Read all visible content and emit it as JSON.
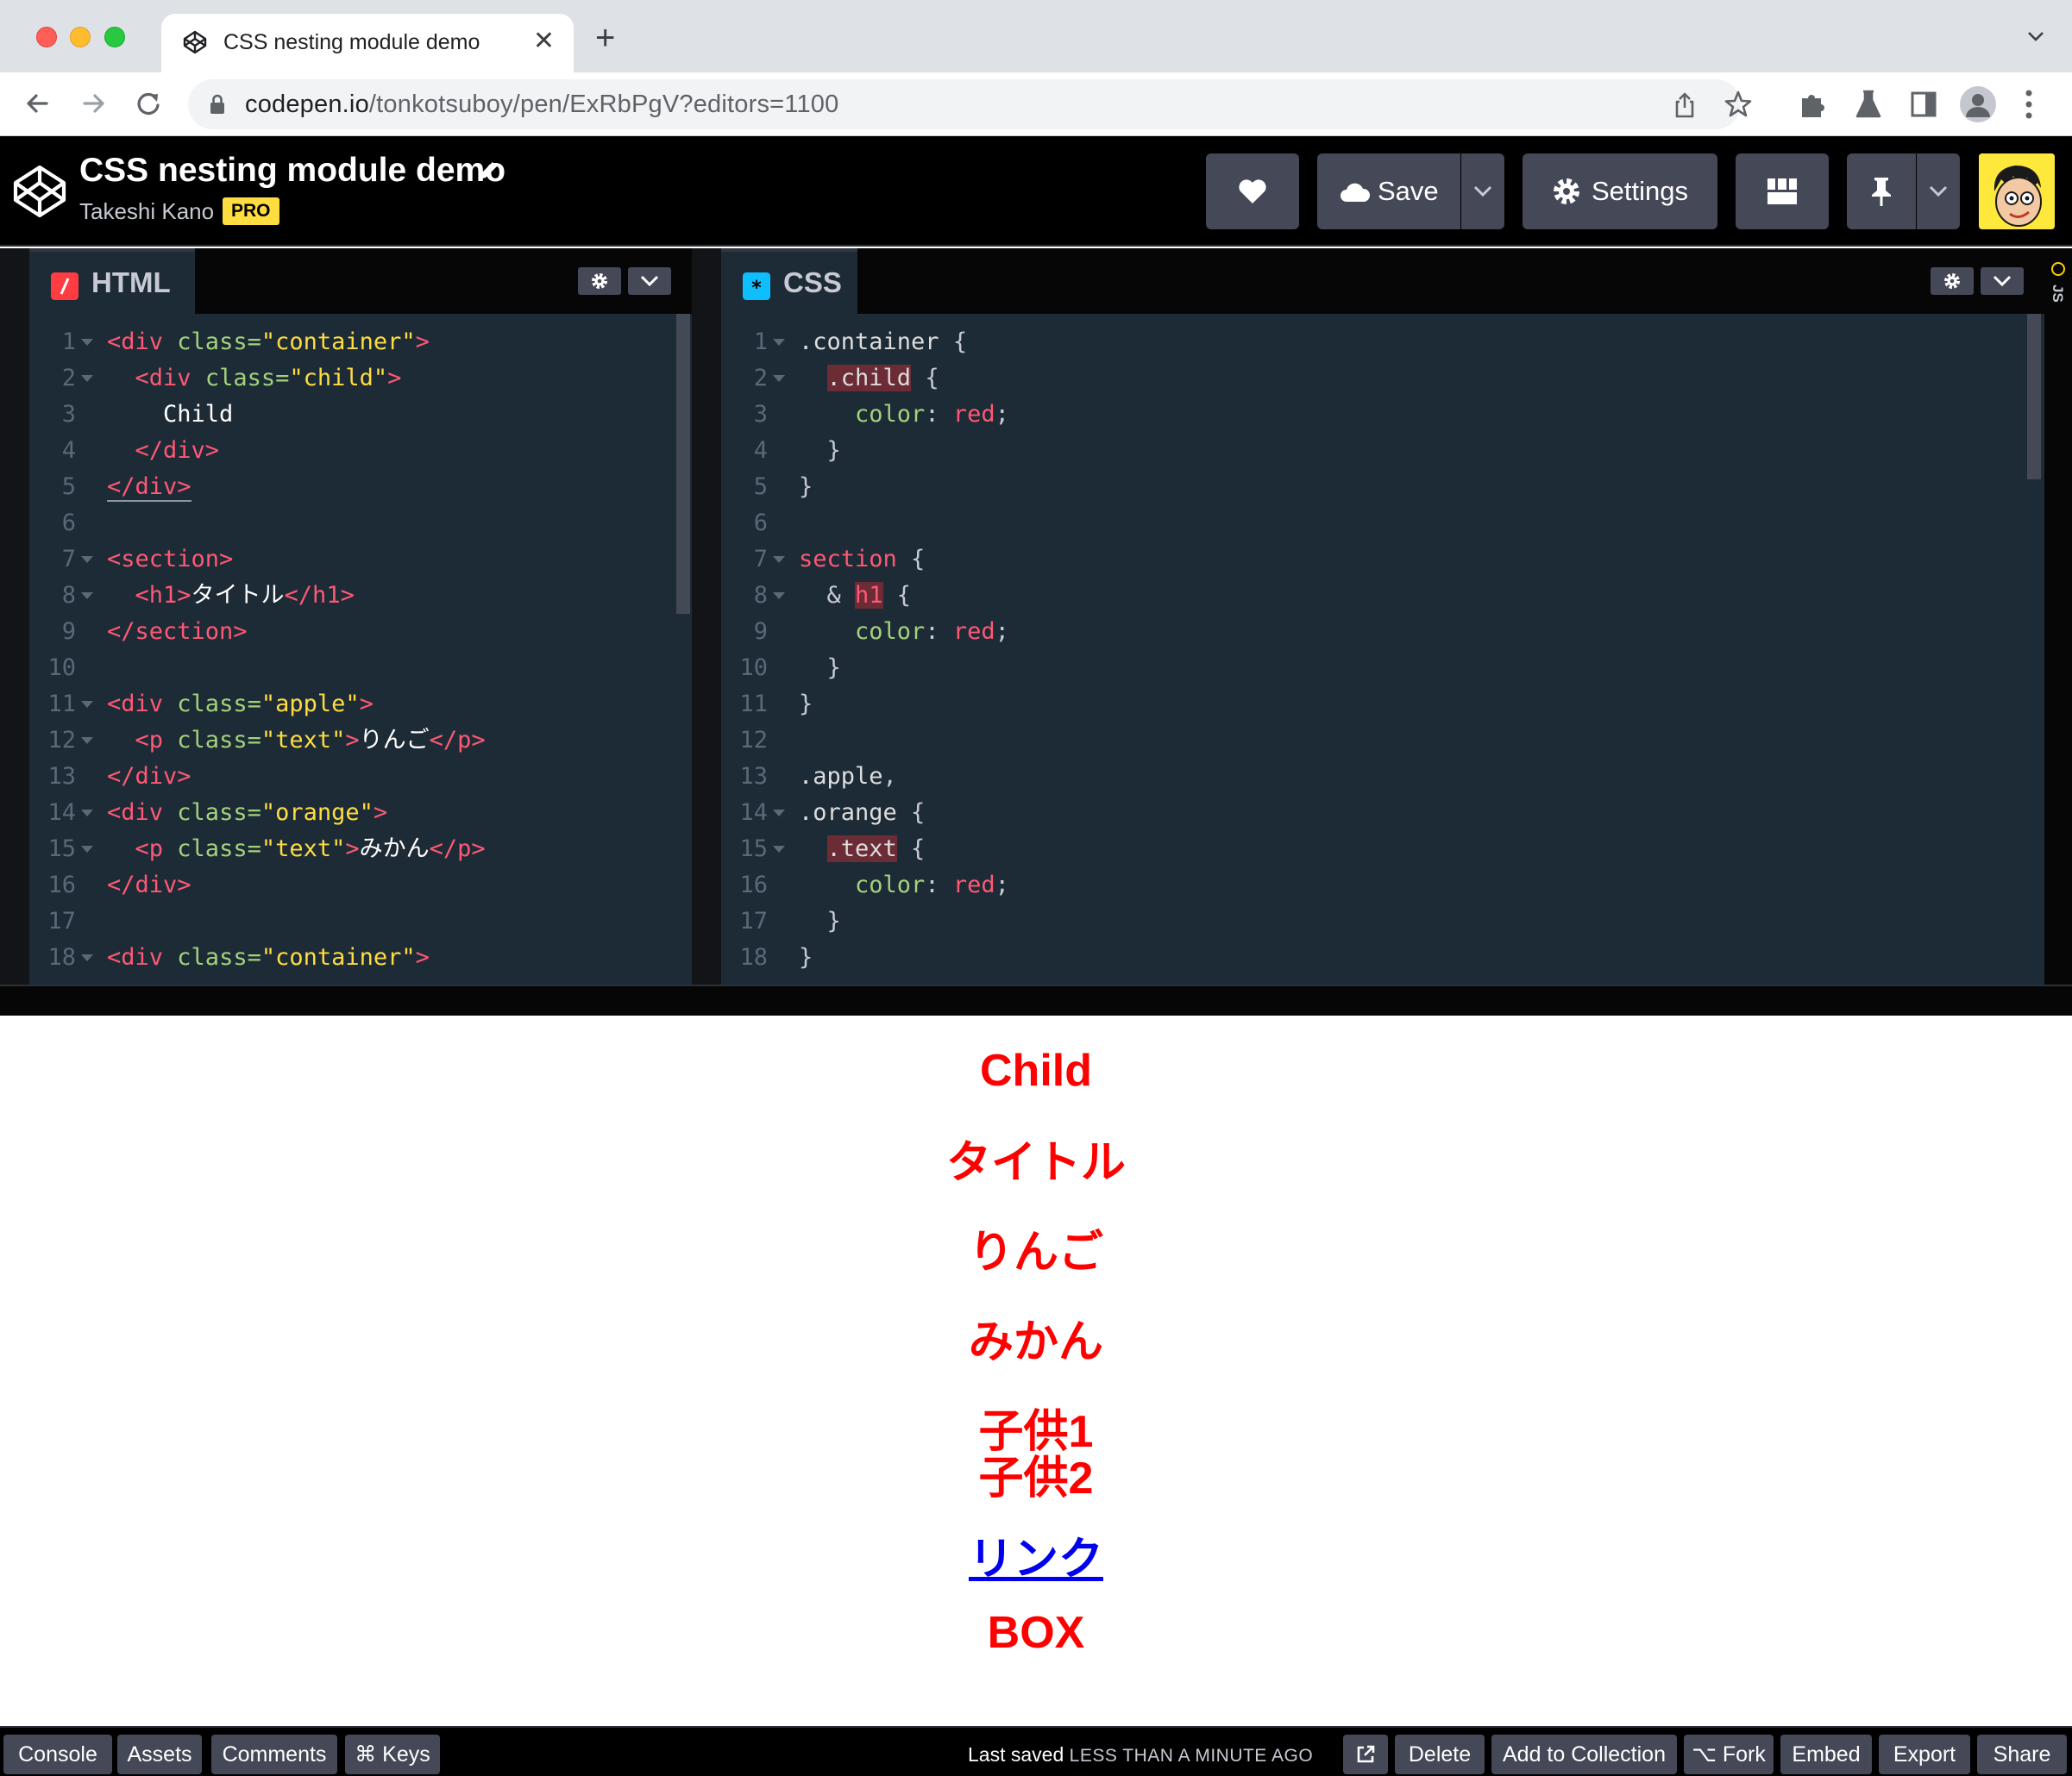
{
  "browser": {
    "tab_title": "CSS nesting module demo",
    "url_host": "codepen.io",
    "url_path": "/tonkotsuboy/pen/ExRbPgV?editors=1100"
  },
  "header": {
    "pen_title": "CSS nesting module demo",
    "author": "Takeshi Kano",
    "badge": "PRO",
    "save_label": "Save",
    "settings_label": "Settings"
  },
  "html_editor": {
    "label": "HTML",
    "lines": [
      {
        "n": "1",
        "fold": true,
        "html": "<span class=\"t-tag\">&lt;div</span> <span class=\"t-attr\">class=</span><span class=\"t-str\">\"container\"</span><span class=\"t-tag\">&gt;</span>"
      },
      {
        "n": "2",
        "fold": true,
        "html": "  <span class=\"t-tag\">&lt;div</span> <span class=\"t-attr\">class=</span><span class=\"t-str\">\"child\"</span><span class=\"t-tag\">&gt;</span>"
      },
      {
        "n": "3",
        "fold": false,
        "html": "    <span class=\"t-txt\">Child</span>"
      },
      {
        "n": "4",
        "fold": false,
        "html": "  <span class=\"t-tag\">&lt;/div&gt;</span>"
      },
      {
        "n": "5",
        "fold": false,
        "html": "<span class=\"t-tag\" style=\"border-bottom:2px solid #8b97a5\">&lt;/div&gt;</span>"
      },
      {
        "n": "6",
        "fold": false,
        "html": ""
      },
      {
        "n": "7",
        "fold": true,
        "html": "<span class=\"t-tag\">&lt;section&gt;</span>"
      },
      {
        "n": "8",
        "fold": true,
        "html": "  <span class=\"t-tag\">&lt;h1&gt;</span><span class=\"t-txt\">タイトル</span><span class=\"t-tag\">&lt;/h1&gt;</span>"
      },
      {
        "n": "9",
        "fold": false,
        "html": "<span class=\"t-tag\">&lt;/section&gt;</span>"
      },
      {
        "n": "10",
        "fold": false,
        "html": ""
      },
      {
        "n": "11",
        "fold": true,
        "html": "<span class=\"t-tag\">&lt;div</span> <span class=\"t-attr\">class=</span><span class=\"t-str\">\"apple\"</span><span class=\"t-tag\">&gt;</span>"
      },
      {
        "n": "12",
        "fold": true,
        "html": "  <span class=\"t-tag\">&lt;p</span> <span class=\"t-attr\">class=</span><span class=\"t-str\">\"text\"</span><span class=\"t-tag\">&gt;</span><span class=\"t-txt\">りんご</span><span class=\"t-tag\">&lt;/p&gt;</span>"
      },
      {
        "n": "13",
        "fold": false,
        "html": "<span class=\"t-tag\">&lt;/div&gt;</span>"
      },
      {
        "n": "14",
        "fold": true,
        "html": "<span class=\"t-tag\">&lt;div</span> <span class=\"t-attr\">class=</span><span class=\"t-str\">\"orange\"</span><span class=\"t-tag\">&gt;</span>"
      },
      {
        "n": "15",
        "fold": true,
        "html": "  <span class=\"t-tag\">&lt;p</span> <span class=\"t-attr\">class=</span><span class=\"t-str\">\"text\"</span><span class=\"t-tag\">&gt;</span><span class=\"t-txt\">みかん</span><span class=\"t-tag\">&lt;/p&gt;</span>"
      },
      {
        "n": "16",
        "fold": false,
        "html": "<span class=\"t-tag\">&lt;/div&gt;</span>"
      },
      {
        "n": "17",
        "fold": false,
        "html": ""
      },
      {
        "n": "18",
        "fold": true,
        "html": "<span class=\"t-tag\">&lt;div</span> <span class=\"t-attr\">class=</span><span class=\"t-str\">\"container\"</span><span class=\"t-tag\">&gt;</span>"
      }
    ]
  },
  "css_editor": {
    "label": "CSS",
    "lines": [
      {
        "n": "1",
        "fold": true,
        "html": "<span class=\"t-sel\">.container</span> {"
      },
      {
        "n": "2",
        "fold": true,
        "html": "  <span class=\"t-sel hl\">.child</span> {"
      },
      {
        "n": "3",
        "fold": false,
        "html": "    <span class=\"t-prop\">color</span>: <span class=\"t-val\">red</span>;"
      },
      {
        "n": "4",
        "fold": false,
        "html": "  }"
      },
      {
        "n": "5",
        "fold": false,
        "html": "}"
      },
      {
        "n": "6",
        "fold": false,
        "html": ""
      },
      {
        "n": "7",
        "fold": true,
        "html": "<span class=\"t-kw\">section</span> {"
      },
      {
        "n": "8",
        "fold": true,
        "html": "  &amp; <span class=\"t-kw hl\">h1</span> {"
      },
      {
        "n": "9",
        "fold": false,
        "html": "    <span class=\"t-prop\">color</span>: <span class=\"t-val\">red</span>;"
      },
      {
        "n": "10",
        "fold": false,
        "html": "  }"
      },
      {
        "n": "11",
        "fold": false,
        "html": "}"
      },
      {
        "n": "12",
        "fold": false,
        "html": ""
      },
      {
        "n": "13",
        "fold": false,
        "html": "<span class=\"t-sel\">.apple</span>,"
      },
      {
        "n": "14",
        "fold": true,
        "html": "<span class=\"t-sel\">.orange</span> {"
      },
      {
        "n": "15",
        "fold": true,
        "html": "  <span class=\"t-sel hl\">.text</span> {"
      },
      {
        "n": "16",
        "fold": false,
        "html": "    <span class=\"t-prop\">color</span>: <span class=\"t-val\">red</span>;"
      },
      {
        "n": "17",
        "fold": false,
        "html": "  }"
      },
      {
        "n": "18",
        "fold": false,
        "html": "}"
      }
    ]
  },
  "js_label": "JS",
  "preview": {
    "child": "Child",
    "title": "タイトル",
    "apple": "りんご",
    "orange": "みかん",
    "kid1": "子供1",
    "kid2": "子供2",
    "link": "リンク",
    "box": "BOX"
  },
  "footer": {
    "console": "Console",
    "assets": "Assets",
    "comments": "Comments",
    "keys": "⌘ Keys",
    "last_saved_prefix": "Last saved",
    "last_saved_when": "LESS THAN A MINUTE AGO",
    "delete": "Delete",
    "add_to_collection": "Add to Collection",
    "fork": "⌥ Fork",
    "embed": "Embed",
    "export": "Export",
    "share": "Share"
  },
  "colors": {
    "codepen_yellow": "#ffdd40",
    "editor_bg": "#1d2b36",
    "preview_text": "#ff0000",
    "link": "#0000ee"
  },
  "icons": [
    "codepen-logo-icon",
    "pencil-icon",
    "heart-icon",
    "cloud-icon",
    "gear-icon",
    "layout-icon",
    "pin-icon",
    "chevron-down-icon",
    "lock-icon",
    "star-icon",
    "puzzle-icon",
    "flask-icon",
    "side-panel-icon",
    "profile-icon",
    "external-link-icon"
  ]
}
